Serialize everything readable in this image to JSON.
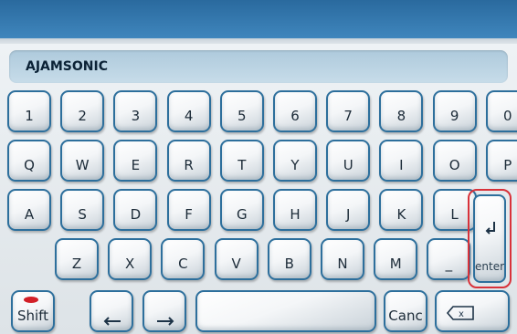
{
  "input": {
    "value": "AJAMSONIC"
  },
  "rows": {
    "numbers": [
      "1",
      "2",
      "3",
      "4",
      "5",
      "6",
      "7",
      "8",
      "9",
      "0"
    ],
    "top": [
      "Q",
      "W",
      "E",
      "R",
      "T",
      "Y",
      "U",
      "I",
      "O",
      "P"
    ],
    "home": [
      "A",
      "S",
      "D",
      "F",
      "G",
      "H",
      "J",
      "K",
      "L"
    ],
    "bottom": [
      "Z",
      "X",
      "C",
      "V",
      "B",
      "N",
      "M",
      "_"
    ]
  },
  "keys": {
    "enter": "enter",
    "shift": "Shift",
    "canc": "Canc",
    "left": "←",
    "right": "→",
    "backspace": "x"
  },
  "colors": {
    "header": "#3a7fb6",
    "key_border": "#2d6f9c",
    "enter_highlight": "#d8323a",
    "shift_indicator": "#d21f27"
  },
  "icons": {
    "enter": "return-arrow-icon",
    "backspace": "backspace-icon",
    "left": "arrow-left-icon",
    "right": "arrow-right-icon"
  }
}
